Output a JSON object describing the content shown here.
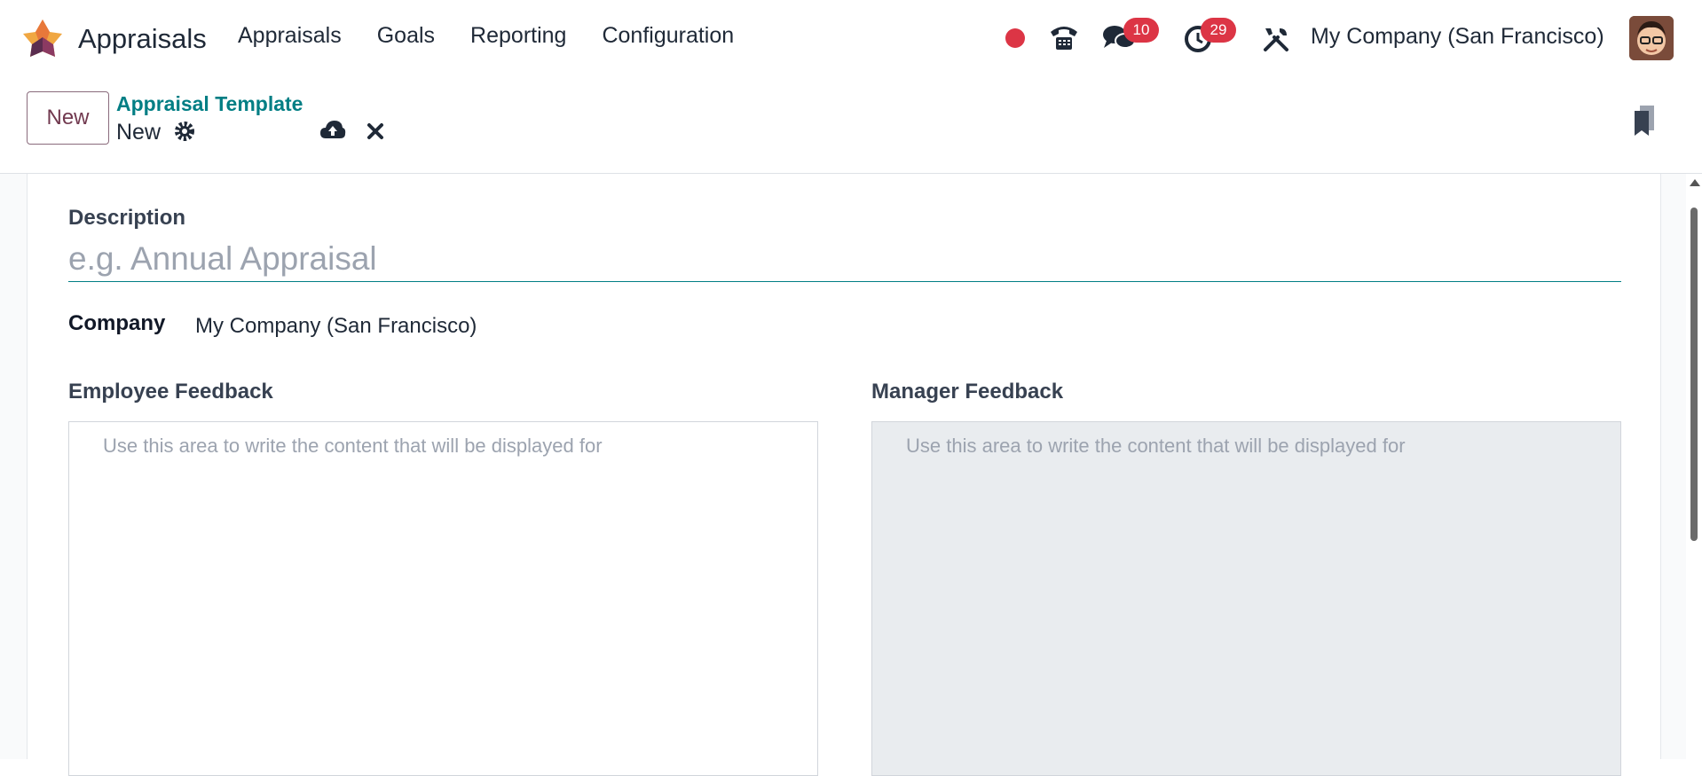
{
  "app": {
    "name": "Appraisals",
    "menu": [
      "Appraisals",
      "Goals",
      "Reporting",
      "Configuration"
    ]
  },
  "systray": {
    "messages_count": "10",
    "activities_count": "29",
    "company": "My Company (San Francisco)"
  },
  "control_panel": {
    "new_label": "New",
    "breadcrumb": "Appraisal Template",
    "record_name": "New"
  },
  "form": {
    "description_label": "Description",
    "description_placeholder": "e.g. Annual Appraisal",
    "company_label": "Company",
    "company_value": "My Company (San Francisco)",
    "employee_feedback_label": "Employee Feedback",
    "employee_feedback_placeholder": "Use this area to write the content that will be displayed for",
    "manager_feedback_label": "Manager Feedback",
    "manager_feedback_placeholder": "Use this area to write the content that will be displayed for"
  },
  "colors": {
    "accent": "#017e84",
    "primary": "#71394f",
    "badge": "#dc3545"
  },
  "icons": [
    "app-logo-icon",
    "phone-icon",
    "chat-icon",
    "clock-icon",
    "tools-icon",
    "gear-icon",
    "cloud-upload-icon",
    "close-icon",
    "bookmark-icon"
  ]
}
